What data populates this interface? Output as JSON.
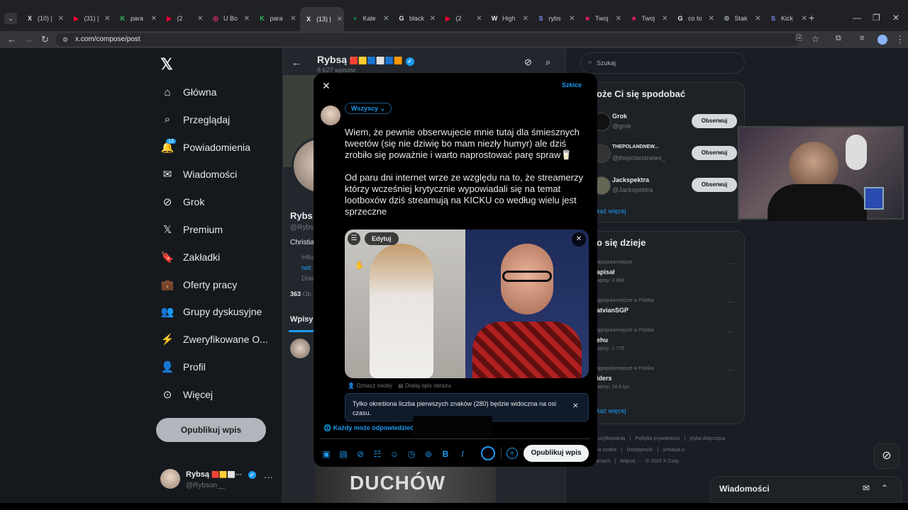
{
  "browser": {
    "tabs": [
      {
        "label": "(10) |",
        "color": "#e8eaed",
        "glyph": "X"
      },
      {
        "label": "(31) |",
        "color": "#ff0033",
        "glyph": "▶"
      },
      {
        "label": "para",
        "color": "#30c060",
        "glyph": "K"
      },
      {
        "label": "(2",
        "color": "#ff0033",
        "glyph": "▶"
      },
      {
        "label": "U Bo",
        "color": "#e1306c",
        "glyph": "◎"
      },
      {
        "label": "para",
        "color": "#30c060",
        "glyph": "K"
      },
      {
        "label": "(13) |",
        "color": "#e8eaed",
        "glyph": "X",
        "active": true
      },
      {
        "label": "Kale",
        "color": "#0f9d58",
        "glyph": "+"
      },
      {
        "label": "black",
        "color": "#e8eaed",
        "glyph": "G"
      },
      {
        "label": "(2",
        "color": "#ff0033",
        "glyph": "▶"
      },
      {
        "label": "High",
        "color": "#e8eaed",
        "glyph": "W"
      },
      {
        "label": "rybs",
        "color": "#7b8cff",
        "glyph": "S"
      },
      {
        "label": "Twoj",
        "color": "#e91e63",
        "glyph": "★"
      },
      {
        "label": "Twoj",
        "color": "#e91e63",
        "glyph": "★"
      },
      {
        "label": "co to",
        "color": "#e8eaed",
        "glyph": "G"
      },
      {
        "label": "Stak",
        "color": "#9aa0a6",
        "glyph": "⚙"
      },
      {
        "label": "Kick",
        "color": "#7b8cff",
        "glyph": "S"
      }
    ],
    "url": "x.com/compose/post"
  },
  "sidebar": {
    "items": [
      {
        "label": "Główna",
        "icon": "home-icon"
      },
      {
        "label": "Przeglądaj",
        "icon": "search-icon"
      },
      {
        "label": "Powiadomienia",
        "icon": "bell-icon",
        "badge": "13"
      },
      {
        "label": "Wiadomości",
        "icon": "mail-icon"
      },
      {
        "label": "Grok",
        "icon": "grok-icon"
      },
      {
        "label": "Premium",
        "icon": "x-logo-icon"
      },
      {
        "label": "Zakładki",
        "icon": "bookmark-icon"
      },
      {
        "label": "Oferty pracy",
        "icon": "briefcase-icon"
      },
      {
        "label": "Grupy dyskusyjne",
        "icon": "people-icon"
      },
      {
        "label": "Zweryfikowane O...",
        "icon": "lightning-icon"
      },
      {
        "label": "Profil",
        "icon": "person-icon"
      },
      {
        "label": "Więcej",
        "icon": "more-circle-icon"
      }
    ],
    "post_button": "Opublikuj wpis",
    "account": {
      "name": "Rybsą",
      "handle": "@Rybson__"
    }
  },
  "middle": {
    "name": "Rybsą",
    "posts_count": "8 627 wpisów",
    "profile_name": "Rybs",
    "profile_handle": "@Rybs",
    "bio": "Christia",
    "link1": "Influ",
    "link2": "twit",
    "link3": "Dołą",
    "followers_num": "363",
    "followers_lbl": "Ob",
    "tab": "Wpisy",
    "banner_text": "DUCHÓW"
  },
  "right": {
    "search_placeholder": "Szukaj",
    "who_to_follow_title": "oże Ci się spodobać",
    "follow": [
      {
        "name": "Grok",
        "handle": "@grok",
        "button": "Obserwuj"
      },
      {
        "name": "THEPOLANDNEW...",
        "handle": "@thepolandnews_",
        "button": "Obserwuj"
      },
      {
        "name": "Jackspektra",
        "handle": "@Jackspektra",
        "button": "Obserwuj"
      }
    ],
    "show_more": "każ więcej",
    "trends_title": "o się dzieje",
    "trends": [
      {
        "context": "ajpopularniejsze",
        "name": "apisał",
        "count": "wpisy: 3 894"
      },
      {
        "context": "ajpopularniejsze w Polska",
        "name": "atvianSGP",
        "count": ""
      },
      {
        "context": "ajpopularniejsze w Polska",
        "name": "ehu",
        "count": "wpisy: 1 776"
      },
      {
        "context": "ajpopularniejsze w Polska",
        "name": "iders",
        "count": "wpisy: 14,6 tys."
      }
    ],
    "show_more2": "każ więcej",
    "footer": [
      "unki użytkowania",
      "|",
      "Polityka prywatności",
      "|",
      "ytyka dotycząca plików cookie",
      "|",
      "Dostępność",
      "|",
      "ormacja o reklamach",
      "|",
      "Więcej ···",
      "© 2025 X Corp."
    ],
    "messages": "Wiadomości"
  },
  "modal": {
    "drafts": "Szkice",
    "audience": "Wszyscy",
    "paragraph1": "Wiem, że pewnie obserwujecie mnie tutaj dla śmiesznych tweetów (się nie dziwię bo mam niezły humyr) ale dziś zrobiło się poważnie i warto naprostować parę spraw🥛",
    "paragraph2": "Od paru dni internet wrze ze względu na to, że streamerzy którzy wcześniej krytycznie wypowiadali się na temat lootboxów dziś streamują na KICKU co według wielu jest sprzeczne",
    "edit_label": "Edytuj",
    "tag_people": "Oznacz osoby",
    "add_alt": "Dodaj opis obrazu",
    "notice": "Tylko określona liczba pierwszych znaków (280) będzie widoczna na osi czasu.",
    "reply_setting": "Każdy może odpowiedzieć",
    "publish": "Opublikuj wpis",
    "toolbar_icons": [
      "image-icon",
      "gif-icon",
      "grok-icon",
      "poll-icon",
      "emoji-icon",
      "schedule-icon",
      "location-icon",
      "bold-icon",
      "italic-icon"
    ]
  },
  "colors": {
    "accent": "#1d9bf0",
    "verified": "#1d9bf0",
    "gold": "#e2b719"
  }
}
